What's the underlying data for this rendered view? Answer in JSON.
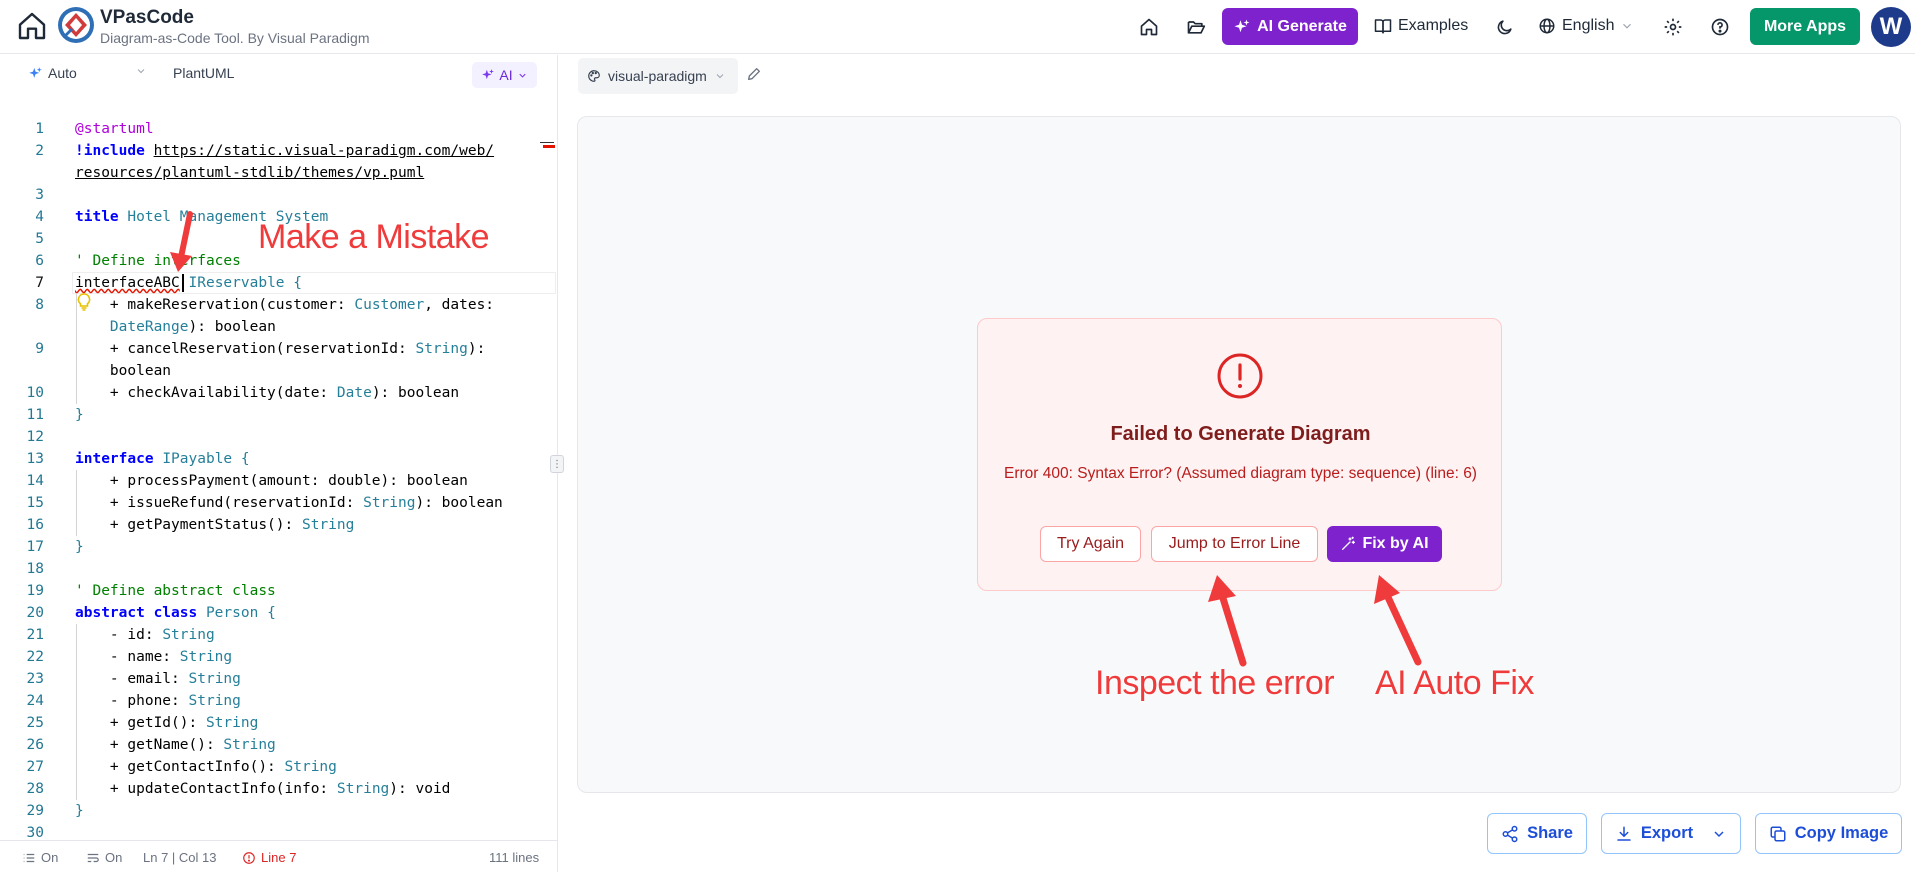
{
  "header": {
    "app_name": "VPasCode",
    "app_subtitle": "Diagram-as-Code Tool. By Visual Paradigm",
    "ai_generate_label": "AI Generate",
    "examples_label": "Examples",
    "language_label": "English",
    "more_apps_label": "More Apps",
    "avatar_initial": "W"
  },
  "editor_toolbar": {
    "mode_label": "Auto",
    "syntax_label": "PlantUML",
    "ai_label": "AI"
  },
  "editor": {
    "lines": [
      {
        "n": "1",
        "parts": [
          [
            "pp",
            "@startuml"
          ]
        ]
      },
      {
        "n": "2",
        "parts": [
          [
            "kw",
            "!include"
          ],
          [
            "",
            " "
          ],
          [
            "url",
            "https://static.visual-paradigm.com/web/"
          ]
        ]
      },
      {
        "n": "",
        "parts": [
          [
            "url",
            "resources/plantuml-stdlib/themes/vp.puml"
          ]
        ]
      },
      {
        "n": "3",
        "parts": []
      },
      {
        "n": "4",
        "parts": [
          [
            "kw",
            "title"
          ],
          [
            "title-c",
            " Hotel Management System"
          ]
        ]
      },
      {
        "n": "5",
        "parts": []
      },
      {
        "n": "6",
        "parts": [
          [
            "cm",
            "' Define interfaces"
          ]
        ]
      },
      {
        "n": "7",
        "parts": [
          [
            "squiggle",
            "interfaceABC"
          ],
          [
            "",
            " "
          ],
          [
            "ty",
            "IReservable"
          ],
          [
            "",
            " "
          ],
          [
            "ty",
            "{"
          ]
        ]
      },
      {
        "n": "8",
        "parts": [
          [
            "",
            "    + makeReservation(customer: "
          ],
          [
            "ty",
            "Customer"
          ],
          [
            "",
            ", dates:"
          ]
        ]
      },
      {
        "n": "",
        "parts": [
          [
            "",
            "    "
          ],
          [
            "ty",
            "DateRange"
          ],
          [
            "",
            "): boolean"
          ]
        ]
      },
      {
        "n": "9",
        "parts": [
          [
            "",
            "    + cancelReservation(reservationId: "
          ],
          [
            "ty",
            "String"
          ],
          [
            "",
            "):"
          ]
        ]
      },
      {
        "n": "",
        "parts": [
          [
            "",
            "    boolean"
          ]
        ]
      },
      {
        "n": "10",
        "parts": [
          [
            "",
            "    + checkAvailability(date: "
          ],
          [
            "ty",
            "Date"
          ],
          [
            "",
            "): boolean"
          ]
        ]
      },
      {
        "n": "11",
        "parts": [
          [
            "ty",
            "}"
          ]
        ]
      },
      {
        "n": "12",
        "parts": []
      },
      {
        "n": "13",
        "parts": [
          [
            "kw",
            "interface"
          ],
          [
            "",
            " "
          ],
          [
            "ty",
            "IPayable"
          ],
          [
            "",
            " "
          ],
          [
            "ty",
            "{"
          ]
        ]
      },
      {
        "n": "14",
        "parts": [
          [
            "",
            "    + processPayment(amount: double): boolean"
          ]
        ]
      },
      {
        "n": "15",
        "parts": [
          [
            "",
            "    + issueRefund(reservationId: "
          ],
          [
            "ty",
            "String"
          ],
          [
            "",
            "): boolean"
          ]
        ]
      },
      {
        "n": "16",
        "parts": [
          [
            "",
            "    + getPaymentStatus(): "
          ],
          [
            "ty",
            "String"
          ]
        ]
      },
      {
        "n": "17",
        "parts": [
          [
            "ty",
            "}"
          ]
        ]
      },
      {
        "n": "18",
        "parts": []
      },
      {
        "n": "19",
        "parts": [
          [
            "cm",
            "' Define abstract class"
          ]
        ]
      },
      {
        "n": "20",
        "parts": [
          [
            "kw",
            "abstract class"
          ],
          [
            "",
            " "
          ],
          [
            "ty",
            "Person"
          ],
          [
            "",
            " "
          ],
          [
            "ty",
            "{"
          ]
        ]
      },
      {
        "n": "21",
        "parts": [
          [
            "",
            "    - id: "
          ],
          [
            "ty",
            "String"
          ]
        ]
      },
      {
        "n": "22",
        "parts": [
          [
            "",
            "    - name: "
          ],
          [
            "ty",
            "String"
          ]
        ]
      },
      {
        "n": "23",
        "parts": [
          [
            "",
            "    - email: "
          ],
          [
            "ty",
            "String"
          ]
        ]
      },
      {
        "n": "24",
        "parts": [
          [
            "",
            "    - phone: "
          ],
          [
            "ty",
            "String"
          ]
        ]
      },
      {
        "n": "25",
        "parts": [
          [
            "",
            "    + getId(): "
          ],
          [
            "ty",
            "String"
          ]
        ]
      },
      {
        "n": "26",
        "parts": [
          [
            "",
            "    + getName(): "
          ],
          [
            "ty",
            "String"
          ]
        ]
      },
      {
        "n": "27",
        "parts": [
          [
            "",
            "    + getContactInfo(): "
          ],
          [
            "ty",
            "String"
          ]
        ]
      },
      {
        "n": "28",
        "parts": [
          [
            "",
            "    + updateContactInfo(info: "
          ],
          [
            "ty",
            "String"
          ],
          [
            "",
            "): void"
          ]
        ]
      },
      {
        "n": "29",
        "parts": [
          [
            "ty",
            "}"
          ]
        ]
      },
      {
        "n": "30",
        "parts": []
      }
    ]
  },
  "statusbar": {
    "word_wrap": "On",
    "format": "On",
    "cursor_pos": "Ln 7 | Col 13",
    "error_line": "Line 7",
    "line_count": "111 lines"
  },
  "preview": {
    "theme_label": "visual-paradigm",
    "error_title": "Failed to Generate Diagram",
    "error_message": "Error 400: Syntax Error? (Assumed diagram type: sequence) (line: 6)",
    "try_again_label": "Try Again",
    "jump_label": "Jump to Error Line",
    "fix_ai_label": "Fix by AI",
    "share_label": "Share",
    "export_label": "Export",
    "copy_label": "Copy Image"
  },
  "annotations": {
    "mistake": "Make a Mistake",
    "inspect": "Inspect the error",
    "autofix": "AI Auto Fix"
  },
  "colors": {
    "accent_purple": "#7e22ce",
    "more_apps_green": "#059669",
    "error_red": "#dc2626",
    "annotation_red": "#ef3b3b"
  }
}
